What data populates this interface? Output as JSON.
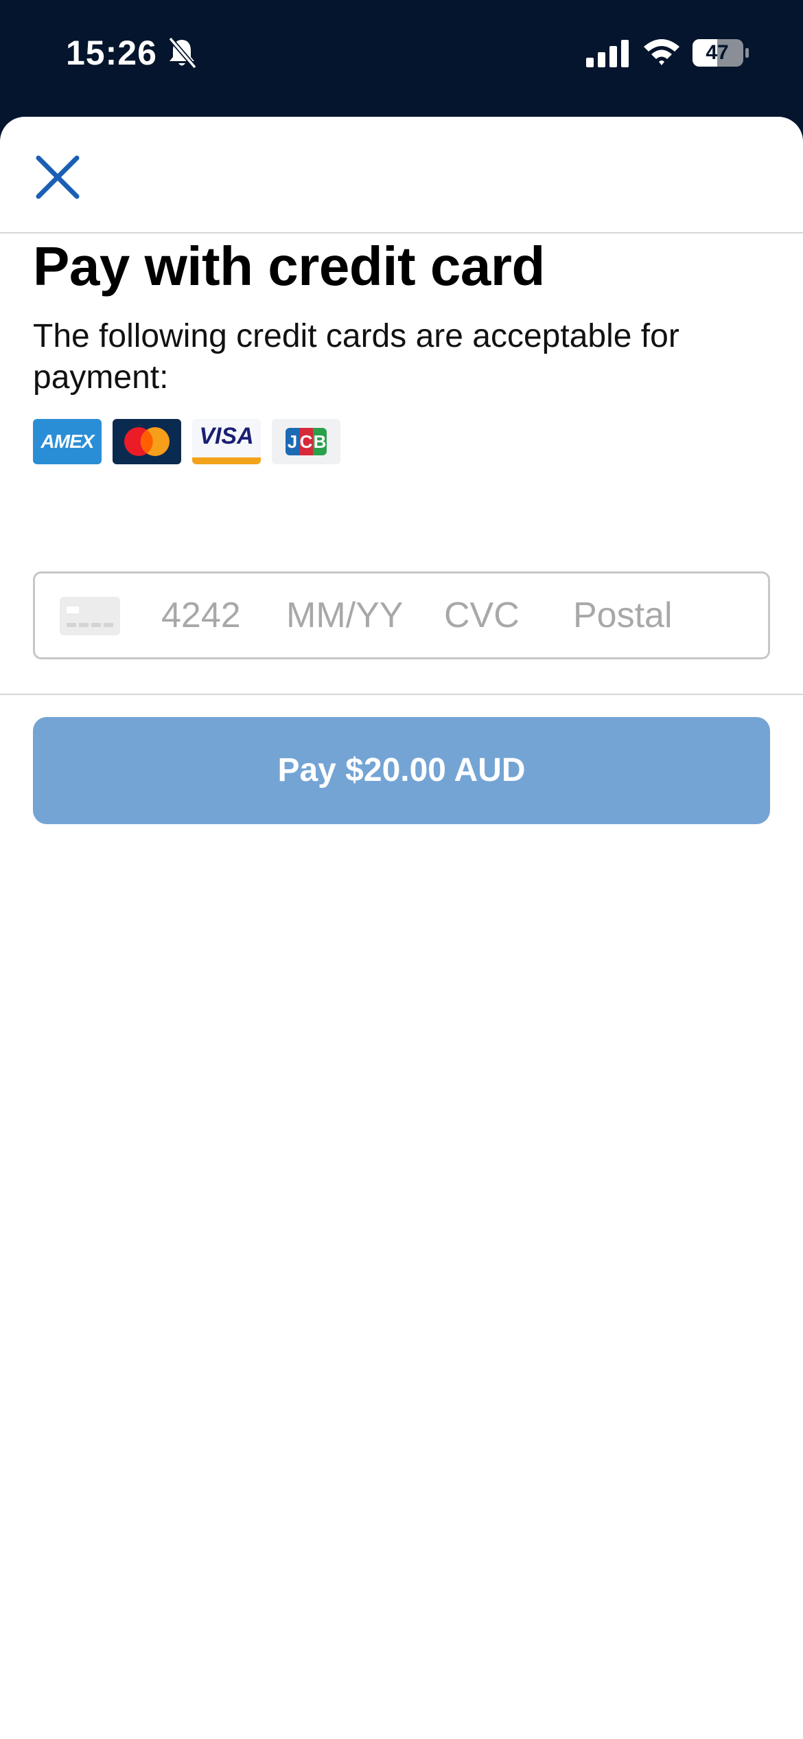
{
  "status_bar": {
    "time": "15:26",
    "battery": "47",
    "icons": [
      "bell-slash-icon",
      "cellular-signal-icon",
      "wifi-icon",
      "battery-icon"
    ]
  },
  "header": {
    "close_icon": "close-icon"
  },
  "main": {
    "title": "Pay with credit card",
    "description": "The following credit cards are acceptable for payment:",
    "accepted_cards": [
      {
        "brand": "amex",
        "label": "AMEX"
      },
      {
        "brand": "mastercard",
        "label": ""
      },
      {
        "brand": "visa",
        "label": "VISA"
      },
      {
        "brand": "jcb",
        "label": "JCB"
      }
    ]
  },
  "card_form": {
    "number_placeholder": "4242",
    "expiry_placeholder": "MM/YY",
    "cvc_placeholder": "CVC",
    "postal_placeholder": "Postal",
    "card_icon": "credit-card-icon"
  },
  "pay_button": {
    "label": "Pay $20.00 AUD"
  },
  "colors": {
    "status_bar_bg": "#05152d",
    "accent": "#1a5fb4",
    "pay_button_disabled": "#74a4d4",
    "divider": "#d6d6d6"
  }
}
